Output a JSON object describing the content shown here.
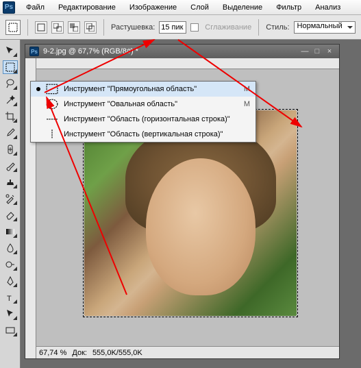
{
  "menu": {
    "items": [
      "Файл",
      "Редактирование",
      "Изображение",
      "Слой",
      "Выделение",
      "Фильтр",
      "Анализ"
    ]
  },
  "options": {
    "feather_label": "Растушевка:",
    "feather_value": "15 пик",
    "antialias_label": "Сглаживание",
    "style_label": "Стиль:",
    "style_value": "Нормальный"
  },
  "doc": {
    "title": "9-2.jpg @ 67,7% (RGB/8#) *",
    "zoom": "67,74 %",
    "docsize_label": "Док:",
    "docsize": "555,0K/555,0K"
  },
  "flyout": {
    "items": [
      {
        "label": "Инструмент \"Прямоугольная область\"",
        "key": "M",
        "active": true
      },
      {
        "label": "Инструмент \"Овальная область\"",
        "key": "M",
        "active": false
      },
      {
        "label": "Инструмент \"Область (горизонтальная строка)\"",
        "key": "",
        "active": false
      },
      {
        "label": "Инструмент \"Область (вертикальная строка)\"",
        "key": "",
        "active": false
      }
    ]
  }
}
